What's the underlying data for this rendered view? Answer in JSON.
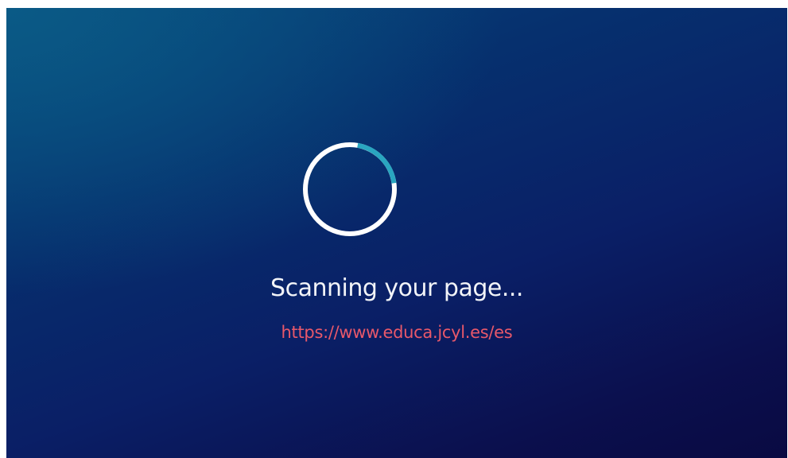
{
  "scan": {
    "status": "Scanning your page...",
    "url": "https://www.educa.jcyl.es/es",
    "spinner_progress": 0.2
  },
  "colors": {
    "background_top": "#07467a",
    "background_bottom": "#090a42",
    "spinner_ring": "#ffffff",
    "spinner_accent": "#2aa6c0",
    "url_text": "#e8586a",
    "status_text": "#f2f4f8"
  },
  "icons": {
    "spinner": "loading-spinner-icon"
  }
}
